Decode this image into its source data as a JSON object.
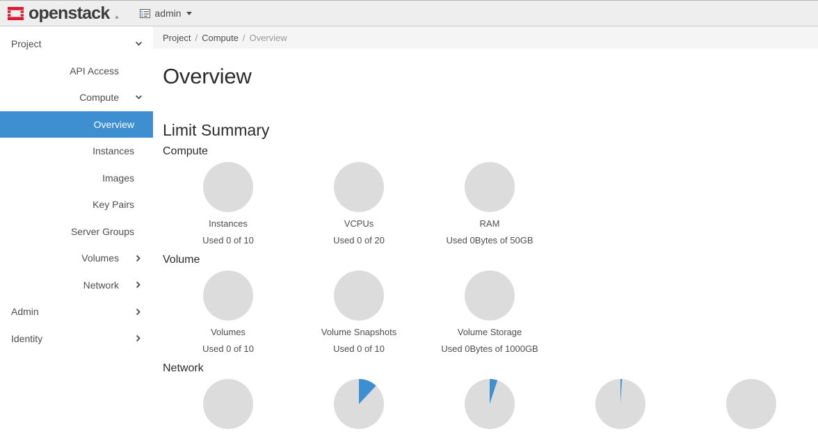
{
  "header": {
    "logo_icon": "openstack-logo-icon",
    "brand_name": "openstack",
    "brand_dot": ".",
    "brand_color": "#da1a32",
    "context_icon": "list-alt-icon",
    "context_label": "admin",
    "caret_icon": "caret-down-icon"
  },
  "sidebar": {
    "items": [
      {
        "label": "Project",
        "level": 0,
        "icon": "chevron-down-icon",
        "active": false
      },
      {
        "label": "API Access",
        "level": 1,
        "icon": "",
        "active": false
      },
      {
        "label": "Compute",
        "level": 1,
        "icon": "chevron-down-icon",
        "active": false
      },
      {
        "label": "Overview",
        "level": 2,
        "icon": "",
        "active": true
      },
      {
        "label": "Instances",
        "level": 2,
        "icon": "",
        "active": false
      },
      {
        "label": "Images",
        "level": 2,
        "icon": "",
        "active": false
      },
      {
        "label": "Key Pairs",
        "level": 2,
        "icon": "",
        "active": false
      },
      {
        "label": "Server Groups",
        "level": 2,
        "icon": "",
        "active": false
      },
      {
        "label": "Volumes",
        "level": 1,
        "icon": "chevron-right-icon",
        "active": false
      },
      {
        "label": "Network",
        "level": 1,
        "icon": "chevron-right-icon",
        "active": false
      },
      {
        "label": "Admin",
        "level": 0,
        "icon": "chevron-right-icon",
        "active": false
      },
      {
        "label": "Identity",
        "level": 0,
        "icon": "chevron-right-icon",
        "active": false
      }
    ],
    "active_color": "#3d8fd1"
  },
  "breadcrumb": {
    "items": [
      {
        "label": "Project",
        "current": false
      },
      {
        "label": "Compute",
        "current": false
      },
      {
        "label": "Overview",
        "current": true
      }
    ],
    "separator": "/"
  },
  "main": {
    "page_title": "Overview",
    "section_title": "Limit Summary",
    "gauge_track_color": "#dcdcdc",
    "gauge_fill_color": "#3d8fd1",
    "groups": [
      {
        "title": "Compute",
        "gauges": [
          {
            "name": "Instances",
            "usage": "Used 0 of 10",
            "percent": 0
          },
          {
            "name": "VCPUs",
            "usage": "Used 0 of 20",
            "percent": 0
          },
          {
            "name": "RAM",
            "usage": "Used 0Bytes of 50GB",
            "percent": 0
          }
        ]
      },
      {
        "title": "Volume",
        "gauges": [
          {
            "name": "Volumes",
            "usage": "Used 0 of 10",
            "percent": 0
          },
          {
            "name": "Volume Snapshots",
            "usage": "Used 0 of 10",
            "percent": 0
          },
          {
            "name": "Volume Storage",
            "usage": "Used 0Bytes of 1000GB",
            "percent": 0
          }
        ]
      },
      {
        "title": "Network",
        "gauges": [
          {
            "name": "",
            "usage": "",
            "percent": 0
          },
          {
            "name": "",
            "usage": "",
            "percent": 12
          },
          {
            "name": "",
            "usage": "",
            "percent": 5
          },
          {
            "name": "",
            "usage": "",
            "percent": 1
          },
          {
            "name": "",
            "usage": "",
            "percent": 0
          }
        ]
      }
    ]
  }
}
